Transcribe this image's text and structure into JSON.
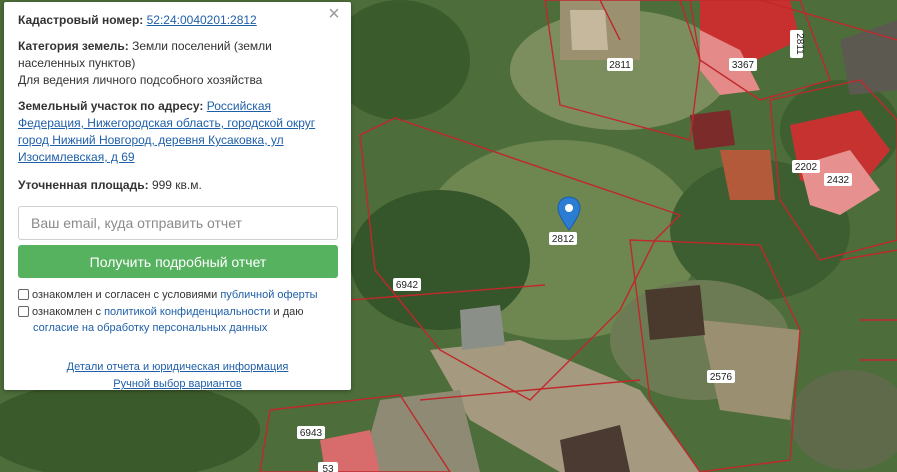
{
  "panel": {
    "cadastral_label": "Кадастровый номер:",
    "cadastral_number": "52:24:0040201:2812",
    "category_label": "Категория земель:",
    "category_value": "Земли поселений (земли населенных пунктов)",
    "category_use": "Для ведения личного подсобного хозяйства",
    "address_label": "Земельный участок по адресу:",
    "address_value": "Российская Федерация, Нижегородская область, городской округ город Нижний Новгород, деревня Кусаковка, ул Изосимлевская, д 69",
    "area_label": "Уточненная площадь:",
    "area_value": "999 кв.м.",
    "email_placeholder": "Ваш email, куда отправить отчет",
    "email_value": "",
    "report_button": "Получить подробный отчет",
    "check1_text": "ознакомлен и согласен с условиями",
    "check1_link": "публичной оферты",
    "check2_text_a": "ознакомлен с",
    "check2_link_a": "политикой конфиденциальности",
    "check2_text_b": "и даю",
    "check2_link_b": "согласие на обработку персональных данных",
    "details_link": "Детали отчета и юридическая информация",
    "manual_link": "Ручной выбор вариантов",
    "close_icon": "×"
  },
  "map": {
    "labels": {
      "p2811": "2811",
      "p3367": "3367",
      "p2811v": "2811",
      "p2202": "2202",
      "p2432": "2432",
      "p2812": "2812",
      "p6942": "6942",
      "p2576": "2576",
      "p6943": "6943",
      "p53": "53"
    },
    "pin_color": "#2b7cd3",
    "boundary_color": "#c0282c"
  }
}
